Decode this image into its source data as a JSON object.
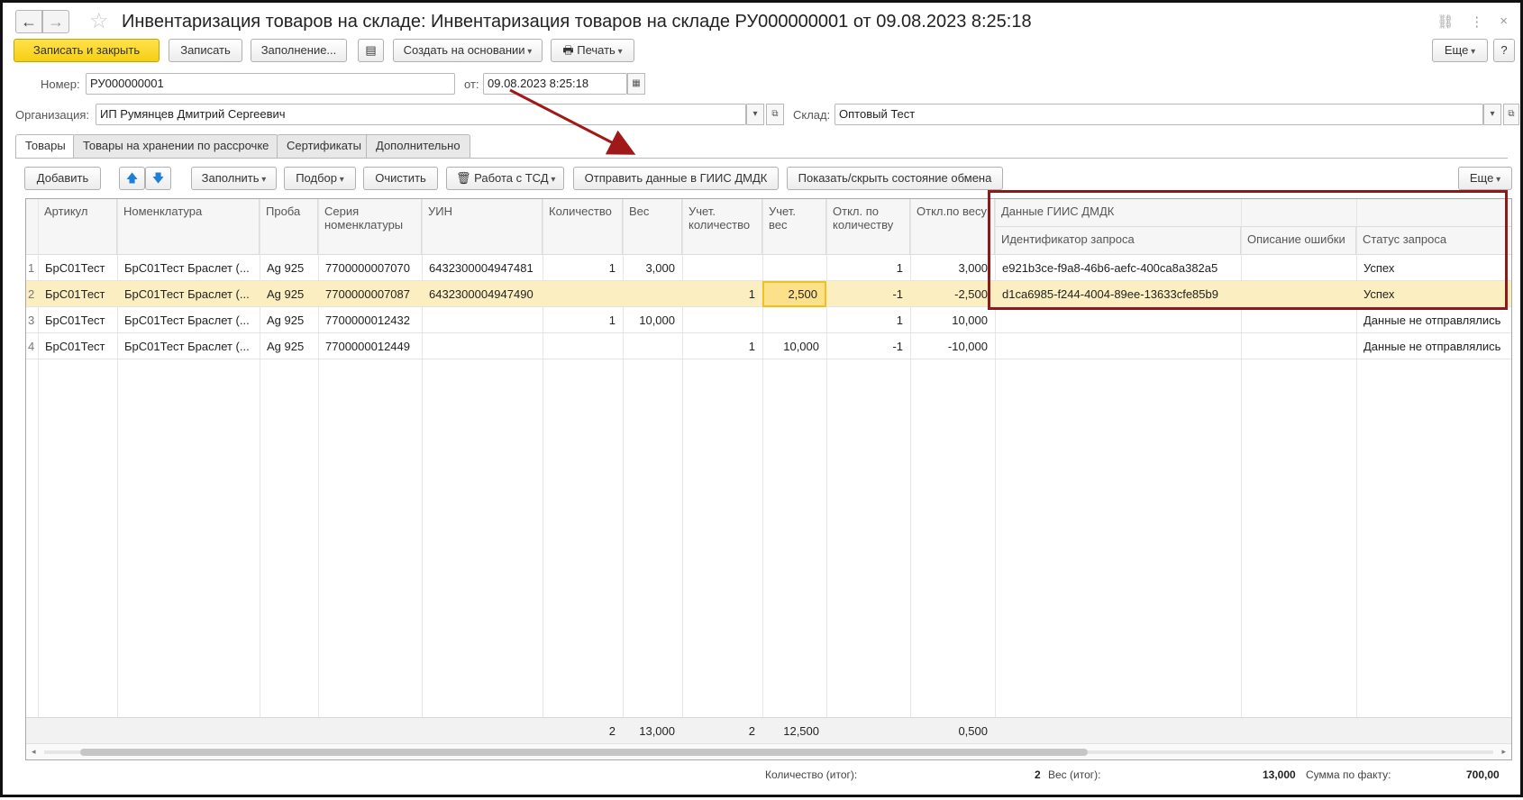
{
  "window": {
    "title": "Инвентаризация товаров на складе: Инвентаризация товаров на складе РУ000000001 от 09.08.2023 8:25:18",
    "back_icon": "←",
    "forward_icon": "→",
    "link_icon": "🔗",
    "menu_icon": "⋮",
    "close_icon": "×"
  },
  "toolbar": {
    "save_close": "Записать и закрыть",
    "save": "Записать",
    "fill": "Заполнение...",
    "create_based": "Создать на основании",
    "print": "Печать",
    "more": "Еще",
    "help": "?"
  },
  "header": {
    "number_label": "Номер:",
    "number_value": "РУ000000001",
    "date_label": "от:",
    "date_value": "09.08.2023  8:25:18",
    "org_label": "Организация:",
    "org_value": "ИП Румянцев Дмитрий Сергеевич",
    "warehouse_label": "Склад:",
    "warehouse_value": "Оптовый Тест"
  },
  "tabs": [
    {
      "label": "Товары",
      "active": true
    },
    {
      "label": "Товары на хранении по рассрочке",
      "active": false
    },
    {
      "label": "Сертификаты",
      "active": false
    },
    {
      "label": "Дополнительно",
      "active": false
    }
  ],
  "table_toolbar": {
    "add": "Добавить",
    "fill": "Заполнить",
    "pick": "Подбор",
    "clear": "Очистить",
    "tsd": "Работа с ТСД",
    "send_giis": "Отправить данные в ГИИС ДМДК",
    "show_hide": "Показать/скрыть состояние обмена",
    "more": "Еще"
  },
  "columns": {
    "article": "Артикул",
    "nomenclature": "Номенклатура",
    "proba": "Проба",
    "series": "Серия\nноменклатуры",
    "uin": "УИН",
    "qty": "Количество",
    "weight": "Вес",
    "acc_qty": "Учет.\nколичество",
    "acc_weight": "Учет.\nвес",
    "dev_qty": "Откл. по\nколичеству",
    "dev_weight": "Откл.по весу",
    "giis_group": "Данные ГИИС ДМДК",
    "request_id": "Идентификатор запроса",
    "error_desc": "Описание ошибки",
    "status": "Статус запроса"
  },
  "rows": [
    {
      "n": "1",
      "article": "БрС01Тест",
      "nomenclature": "БрС01Тест Браслет (...",
      "proba": "Ag 925",
      "series": "7700000007070",
      "uin": "6432300004947481",
      "qty": "1",
      "weight": "3,000",
      "acc_qty": "",
      "acc_weight": "",
      "dev_qty": "1",
      "dev_weight": "3,000",
      "request_id": "e921b3ce-f9a8-46b6-aefc-400ca8a382a5",
      "error_desc": "",
      "status": "Успех"
    },
    {
      "n": "2",
      "article": "БрС01Тест",
      "nomenclature": "БрС01Тест Браслет (...",
      "proba": "Ag 925",
      "series": "7700000007087",
      "uin": "6432300004947490",
      "qty": "",
      "weight": "",
      "acc_qty": "1",
      "acc_weight": "2,500",
      "dev_qty": "-1",
      "dev_weight": "-2,500",
      "request_id": "d1ca6985-f244-4004-89ee-13633cfe85b9",
      "error_desc": "",
      "status": "Успех"
    },
    {
      "n": "3",
      "article": "БрС01Тест",
      "nomenclature": "БрС01Тест Браслет (...",
      "proba": "Ag 925",
      "series": "7700000012432",
      "uin": "",
      "qty": "1",
      "weight": "10,000",
      "acc_qty": "",
      "acc_weight": "",
      "dev_qty": "1",
      "dev_weight": "10,000",
      "request_id": "",
      "error_desc": "",
      "status": "Данные не отправлялись"
    },
    {
      "n": "4",
      "article": "БрС01Тест",
      "nomenclature": "БрС01Тест Браслет (...",
      "proba": "Ag 925",
      "series": "7700000012449",
      "uin": "",
      "qty": "",
      "weight": "",
      "acc_qty": "1",
      "acc_weight": "10,000",
      "dev_qty": "-1",
      "dev_weight": "-10,000",
      "request_id": "",
      "error_desc": "",
      "status": "Данные не отправлялись"
    }
  ],
  "footer": {
    "qty": "2",
    "weight": "13,000",
    "acc_qty": "2",
    "acc_weight": "12,500",
    "dev_weight": "0,500"
  },
  "totals": {
    "qty_label": "Количество (итог):",
    "qty_value": "2",
    "weight_label": "Вес (итог):",
    "weight_value": "13,000",
    "sum_label": "Сумма по факту:",
    "sum_value": "700,00"
  },
  "colors": {
    "accent_yellow": "#f5cf14",
    "selected_row": "#fbeec0",
    "annotation": "#8b1a1a"
  }
}
